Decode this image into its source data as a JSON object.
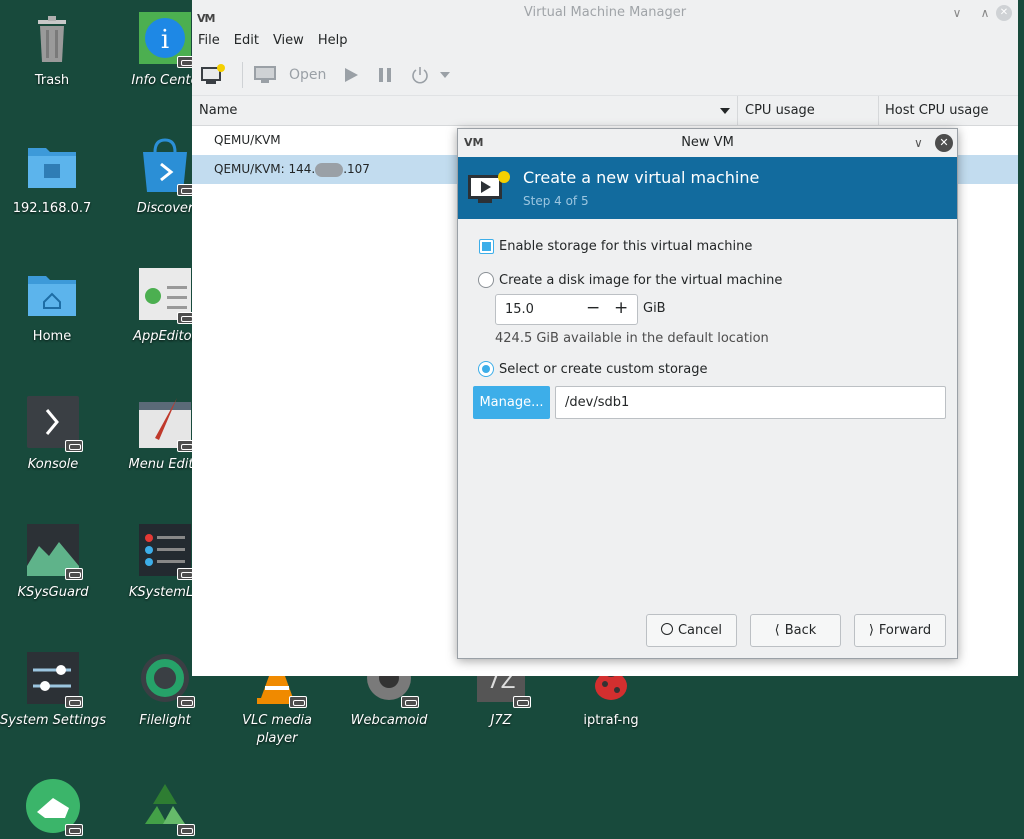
{
  "desktop": {
    "icons": [
      {
        "name": "trash-icon",
        "label": "Trash"
      },
      {
        "name": "info-center-icon",
        "label": "Info Cente"
      },
      {
        "name": "network-folder-icon",
        "label": "192.168.0.7"
      },
      {
        "name": "discover-icon",
        "label": "Discover"
      },
      {
        "name": "home-folder-icon",
        "label": "Home"
      },
      {
        "name": "appeditor-icon",
        "label": "AppEditor"
      },
      {
        "name": "konsole-icon",
        "label": "Konsole"
      },
      {
        "name": "menu-editor-icon",
        "label": "Menu Edito"
      },
      {
        "name": "ksysguard-icon",
        "label": "KSysGuard"
      },
      {
        "name": "ksystemlog-icon",
        "label": "KSystemLo"
      },
      {
        "name": "system-settings-icon",
        "label": "System Settings"
      },
      {
        "name": "filelight-icon",
        "label": "Filelight"
      },
      {
        "name": "vlc-icon",
        "label_line1": "VLC media",
        "label_line2": "player"
      },
      {
        "name": "webcamoid-icon",
        "label": "Webcamoid"
      },
      {
        "name": "j7z-icon",
        "label": "J7Z"
      },
      {
        "name": "iptraf-icon",
        "label": "iptraf-ng"
      }
    ]
  },
  "main_window": {
    "title": "Virtual Machine Manager",
    "logo": "VM",
    "menu": [
      "File",
      "Edit",
      "View",
      "Help"
    ],
    "toolbar": {
      "open_label": "Open"
    },
    "columns": [
      "Name",
      "CPU usage",
      "Host CPU usage"
    ],
    "rows": [
      {
        "label": "QEMU/KVM"
      },
      {
        "label_prefix": "QEMU/KVM: 144.",
        "label_suffix": ".107"
      }
    ]
  },
  "dialog": {
    "title": "New VM",
    "header_title": "Create a new virtual machine",
    "header_step": "Step 4 of 5",
    "enable_storage_label": "Enable storage for this virtual machine",
    "create_disk_label": "Create a disk image for the virtual machine",
    "disk_size_value": "15.0",
    "disk_size_unit": "GiB",
    "available_text": "424.5 GiB available in the default location",
    "custom_storage_label": "Select or create custom storage",
    "manage_label": "Manage...",
    "storage_path": "/dev/sdb1",
    "cancel_label": "Cancel",
    "back_label": "Back",
    "forward_label": "Forward"
  },
  "colors": {
    "accent": "#3daee9",
    "header_blue": "#126b9e",
    "desktop_bg": "#184a3c"
  }
}
